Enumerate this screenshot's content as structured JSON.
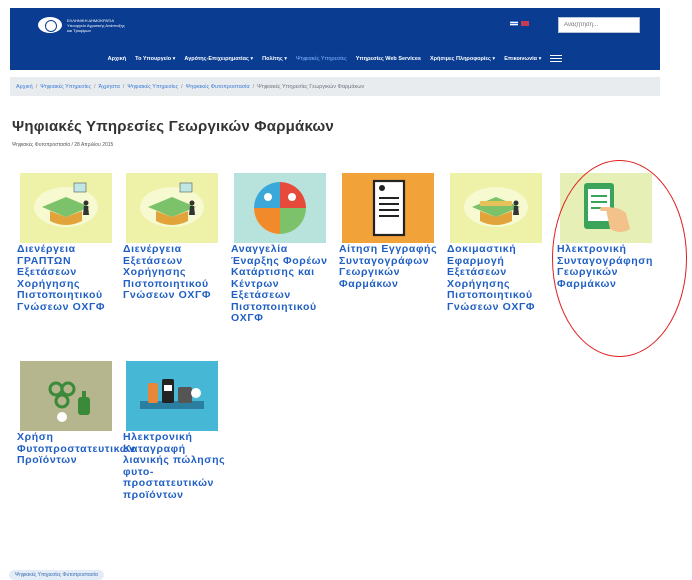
{
  "header": {
    "logo_line1": "ΕΛΛΗΝΙΚΗ ΔΗΜΟΚΡΑΤΙΑ",
    "logo_line2": "Υπουργείο Αγροτικής Ανάπτυξης",
    "logo_line3": "και Τροφίμων",
    "search_placeholder": "Αναζήτηση...",
    "lang_gr": "ΕΛ",
    "lang_en": "EN",
    "nav": [
      {
        "label": "Αρχική",
        "active": false
      },
      {
        "label": "Το Υπουργείο ▾",
        "active": false
      },
      {
        "label": "Αγρότης-Επιχειρηματίας ▾",
        "active": false
      },
      {
        "label": "Πολίτης ▾",
        "active": false
      },
      {
        "label": "Ψηφιακές Υπηρεσίες",
        "active": true
      },
      {
        "label": "Υπηρεσίες Web Services",
        "active": false
      },
      {
        "label": "Χρήσιμες Πληροφορίες ▾",
        "active": false
      },
      {
        "label": "Επικοινωνία ▾",
        "active": false
      }
    ]
  },
  "breadcrumb": [
    "Αρχική",
    "Ψηφιακές Υπηρεσίες",
    "Άχρηστα",
    "Ψηφιακές Υπηρεσίες",
    "Ψηφιακές Φυτοπροστασία",
    "Ψηφιακές Υπηρεσίες Γεωργικών Φαρμάκων"
  ],
  "page": {
    "title": "Ψηφιακές Υπηρεσίες Γεωργικών Φαρμάκων",
    "meta": "Ψηφιακές Φυτοπροστασία  /  28 Απριλίου 2015"
  },
  "services": [
    {
      "label": "Διενέργεια ΓΡΑΠΤΩΝ Εξετάσεων Χορήγησης Πιστοποιητικού Γνώσεων ΟΧΓΦ",
      "icon": "graduation-cap-icon",
      "bg": "#eef2a8"
    },
    {
      "label": "Διενέργεια Εξετάσεων Χορήγησης Πιστοποιητικού Γνώσεων ΟΧΓΦ",
      "icon": "graduation-cap-icon",
      "bg": "#eef2a8"
    },
    {
      "label": "Αναγγελία Έναρξης Φορέων Κατάρτισης και Κέντρων Εξετάσεων Πιστοποιητικού ΟΧΓΦ",
      "icon": "quadrant-icon",
      "bg": "#b7e3dc"
    },
    {
      "label": "Αίτηση Εγγραφής Συνταγογράφων Γεωργικών Φαρμάκων",
      "icon": "document-icon",
      "bg": "#f1a238"
    },
    {
      "label": "Δοκιμαστική Εφαρμογή Εξετάσεων Χορήγησης Πιστοποιητικού Γνώσεων ΟΧΓΦ",
      "icon": "graduation-cap-icon",
      "bg": "#eef2a8"
    },
    {
      "label": "Ηλεκτρονική Συνταγογράφηση Γεωργικών Φαρμάκων",
      "icon": "tablet-hand-icon",
      "bg": "#e6efb5"
    },
    {
      "label": "Χρήση Φυτοπροστατευτικών Προϊόντων",
      "icon": "plant-sprayer-icon",
      "bg": "#b5b58e"
    },
    {
      "label": "Ηλεκτρονική Καταγραφή λιανικής πώλησης φυτο-προστατευτικών προϊόντων",
      "icon": "products-icon",
      "bg": "#46b8d6"
    }
  ],
  "tag": "Ψηφιακές Υπηρεσίες Φυτοπροστασία",
  "colors": {
    "header": "#0a3d91",
    "link": "#1f5fc4",
    "highlight": "#e02020"
  }
}
